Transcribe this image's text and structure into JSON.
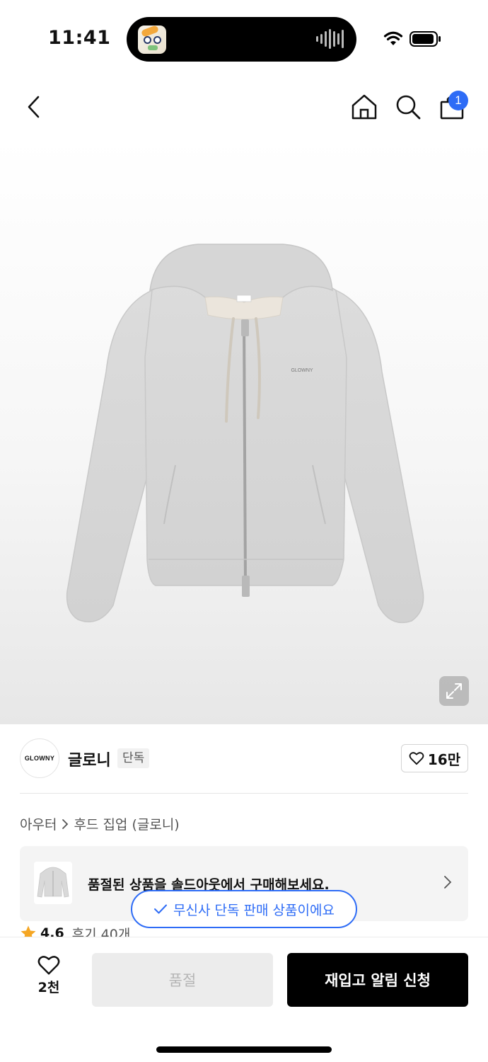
{
  "status_bar": {
    "time": "11:41"
  },
  "nav": {
    "cart_count": "1"
  },
  "brand": {
    "logo_text": "GLOWNY",
    "name": "글로니",
    "tag": "단독",
    "likes": "16만"
  },
  "breadcrumb": {
    "category": "아우터",
    "subcategory": "후드 집업 (글로니)"
  },
  "soldout_banner": {
    "text": "품절된 상품을 솔드아웃에서 구매해보세요."
  },
  "rating": {
    "value": "4.6",
    "reviews": "후기 40개"
  },
  "toast": {
    "text": "무신사 단독 판매 상품이에요"
  },
  "bottom_bar": {
    "wish_count": "2천",
    "soldout_label": "품절",
    "restock_label": "재입고 알림 신청"
  },
  "colors": {
    "accent": "#2e6cf6",
    "primary_button": "#000000",
    "disabled_button": "#ececec",
    "star": "#f5a623"
  }
}
